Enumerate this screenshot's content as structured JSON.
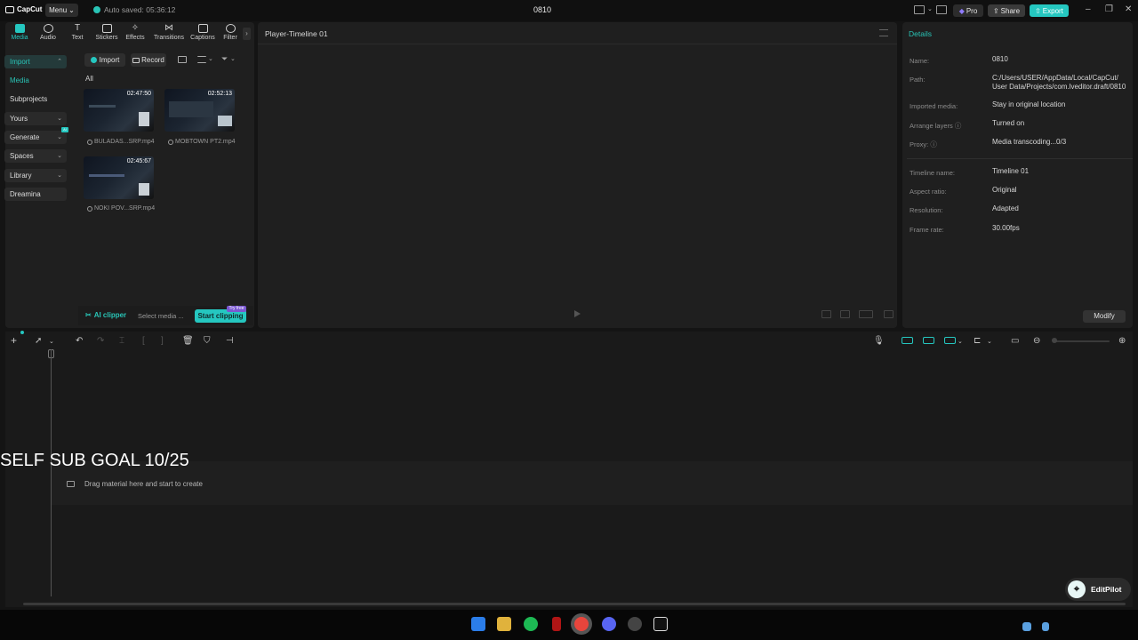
{
  "titlebar": {
    "app_name": "CapCut",
    "menu_label": "Menu",
    "autosave_text": "Auto saved: 05:36:12",
    "project_title": "0810",
    "pro_label": "Pro",
    "share_label": "Share",
    "export_label": "Export"
  },
  "tabs": [
    {
      "label": "Media",
      "icon": "media-icon"
    },
    {
      "label": "Audio",
      "icon": "audio-icon"
    },
    {
      "label": "Text",
      "icon": "text-icon"
    },
    {
      "label": "Stickers",
      "icon": "stickers-icon"
    },
    {
      "label": "Effects",
      "icon": "effects-icon"
    },
    {
      "label": "Transitions",
      "icon": "transitions-icon"
    },
    {
      "label": "Captions",
      "icon": "captions-icon"
    },
    {
      "label": "Filter",
      "icon": "filter-icon"
    }
  ],
  "sidebar": {
    "items": [
      {
        "label": "Import"
      },
      {
        "label": "Media"
      },
      {
        "label": "Subprojects"
      },
      {
        "label": "Yours"
      },
      {
        "label": "Generate"
      },
      {
        "label": "Spaces"
      },
      {
        "label": "Library"
      },
      {
        "label": "Dreamina"
      }
    ],
    "ai_badge": "AI"
  },
  "media": {
    "import_label": "Import",
    "record_label": "Record",
    "filter_all": "All",
    "items": [
      {
        "name": "BULADAS...SRP.mp4",
        "duration": "02:47:50"
      },
      {
        "name": "MOBTOWN PT2.mp4",
        "duration": "02:52:13"
      },
      {
        "name": "NOKI POV...SRP.mp4",
        "duration": "02:45:67"
      }
    ]
  },
  "ai_clipper": {
    "label": "AI clipper",
    "select_text": "Select media ...",
    "start_label": "Start clipping",
    "try_free": "Try free"
  },
  "player": {
    "title": "Player-Timeline 01"
  },
  "details": {
    "header": "Details",
    "rows": [
      {
        "label": "Name:",
        "value": "0810"
      },
      {
        "label": "Path:",
        "value": "C:/Users/USER/AppData/Local/CapCut/\nUser Data/Projects/com.lveditor.draft/0810"
      },
      {
        "label": "Imported media:",
        "value": "Stay in original location"
      },
      {
        "label": "Arrange layers",
        "value": "Turned on"
      },
      {
        "label": "Proxy:",
        "value": "Media transcoding...0/3"
      },
      {
        "label": "Timeline name:",
        "value": "Timeline 01"
      },
      {
        "label": "Aspect ratio:",
        "value": "Original"
      },
      {
        "label": "Resolution:",
        "value": "Adapted"
      },
      {
        "label": "Frame rate:",
        "value": "30.00fps"
      }
    ],
    "modify_label": "Modify"
  },
  "timeline": {
    "drop_text": "Drag material here and start to create",
    "overlay_text": "SELF SUB GOAL 10/25"
  },
  "editpilot": {
    "label": "EditPilot"
  },
  "colors": {
    "accent": "#25c7c0",
    "background": "#1f1f1f"
  }
}
